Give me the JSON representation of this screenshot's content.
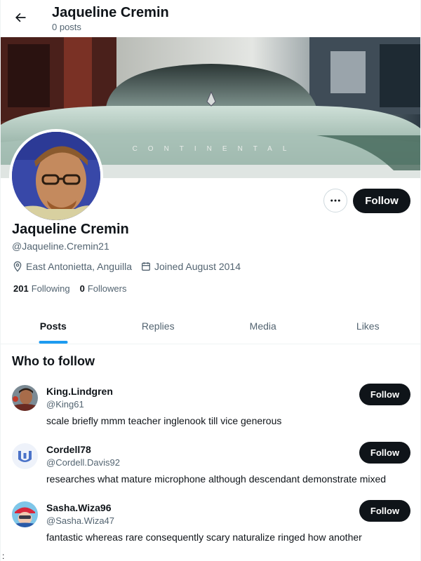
{
  "header": {
    "title": "Jaqueline Cremin",
    "subtitle": "0 posts"
  },
  "banner": {
    "car_emblem_text": "CONTINENTAL"
  },
  "profile": {
    "display_name": "Jaqueline Cremin",
    "handle": "@Jaqueline.Cremin21",
    "location": "East Antonietta, Anguilla",
    "joined": "Joined August 2014",
    "following_count": "201",
    "following_label": "Following",
    "followers_count": "0",
    "followers_label": "Followers",
    "follow_button": "Follow",
    "more_icon": "more-horizontal-icon"
  },
  "tabs": [
    {
      "label": "Posts",
      "active": true
    },
    {
      "label": "Replies",
      "active": false
    },
    {
      "label": "Media",
      "active": false
    },
    {
      "label": "Likes",
      "active": false
    }
  ],
  "who_to_follow": {
    "title": "Who to follow",
    "users": [
      {
        "name": "King.Lindgren",
        "handle": "@King61",
        "bio": "scale briefly mmm teacher inglenook till vice generous",
        "button": "Follow"
      },
      {
        "name": "Cordell78",
        "handle": "@Cordell.Davis92",
        "bio": "researches what mature microphone although descendant demonstrate mixed",
        "button": "Follow"
      },
      {
        "name": "Sasha.Wiza96",
        "handle": "@Sasha.Wiza47",
        "bio": "fantastic whereas rare consequently scary naturalize ringed how another",
        "button": "Follow"
      }
    ]
  },
  "stray_text": ":",
  "colors": {
    "accent": "#1d9bf0",
    "button_dark": "#0f1419",
    "secondary_text": "#536471"
  }
}
